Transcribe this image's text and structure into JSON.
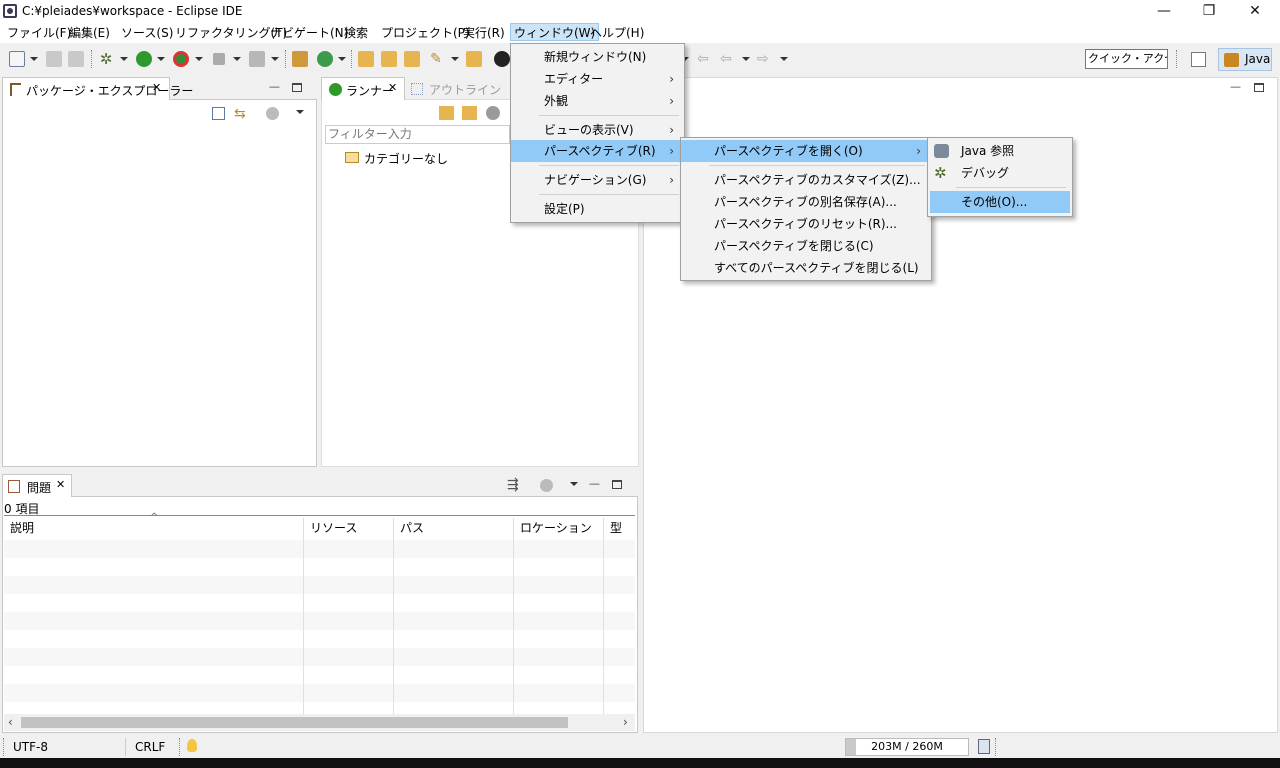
{
  "window": {
    "title": "C:¥pleiades¥workspace - Eclipse IDE",
    "minimize": "—",
    "restore": "❐",
    "close": "✕"
  },
  "menubar": [
    "ファイル(F)",
    "編集(E)",
    "ソース(S)",
    "リファクタリング(T)",
    "ナビゲート(N)",
    "検索",
    "プロジェクト(P)",
    "実行(R)",
    "ウィンドウ(W)",
    "ヘルプ(H)"
  ],
  "toolbar": {
    "quick_access": "クイック・アクセス",
    "perspective": "Java"
  },
  "package_explorer": {
    "title": "パッケージ・エクスプローラー"
  },
  "runner": {
    "tab_runner": "ランナー",
    "tab_outline": "アウトライン",
    "filter_placeholder": "フィルター入力",
    "tree_item": "カテゴリーなし"
  },
  "problems": {
    "title": "問題",
    "count": "0 項目",
    "columns": [
      "説明",
      "リソース",
      "パス",
      "ロケーション",
      "型"
    ]
  },
  "window_menu": {
    "items": [
      "新規ウィンドウ(N)",
      "エディター",
      "外観",
      "ビューの表示(V)",
      "パースペクティブ(R)",
      "ナビゲーション(G)",
      "設定(P)"
    ]
  },
  "perspective_menu": {
    "items": [
      "パースペクティブを開く(O)",
      "パースペクティブのカスタマイズ(Z)...",
      "パースペクティブの別名保存(A)...",
      "パースペクティブのリセット(R)...",
      "パースペクティブを閉じる(C)",
      "すべてのパースペクティブを閉じる(L)"
    ]
  },
  "open_perspective_menu": {
    "items": [
      "Java 参照",
      "デバッグ",
      "その他(O)..."
    ]
  },
  "statusbar": {
    "encoding": "UTF-8",
    "line_delimiter": "CRLF",
    "heap": "203M / 260M"
  },
  "colors": {
    "highlight": "#91c9f7",
    "menu_active": "#cce4f7"
  }
}
